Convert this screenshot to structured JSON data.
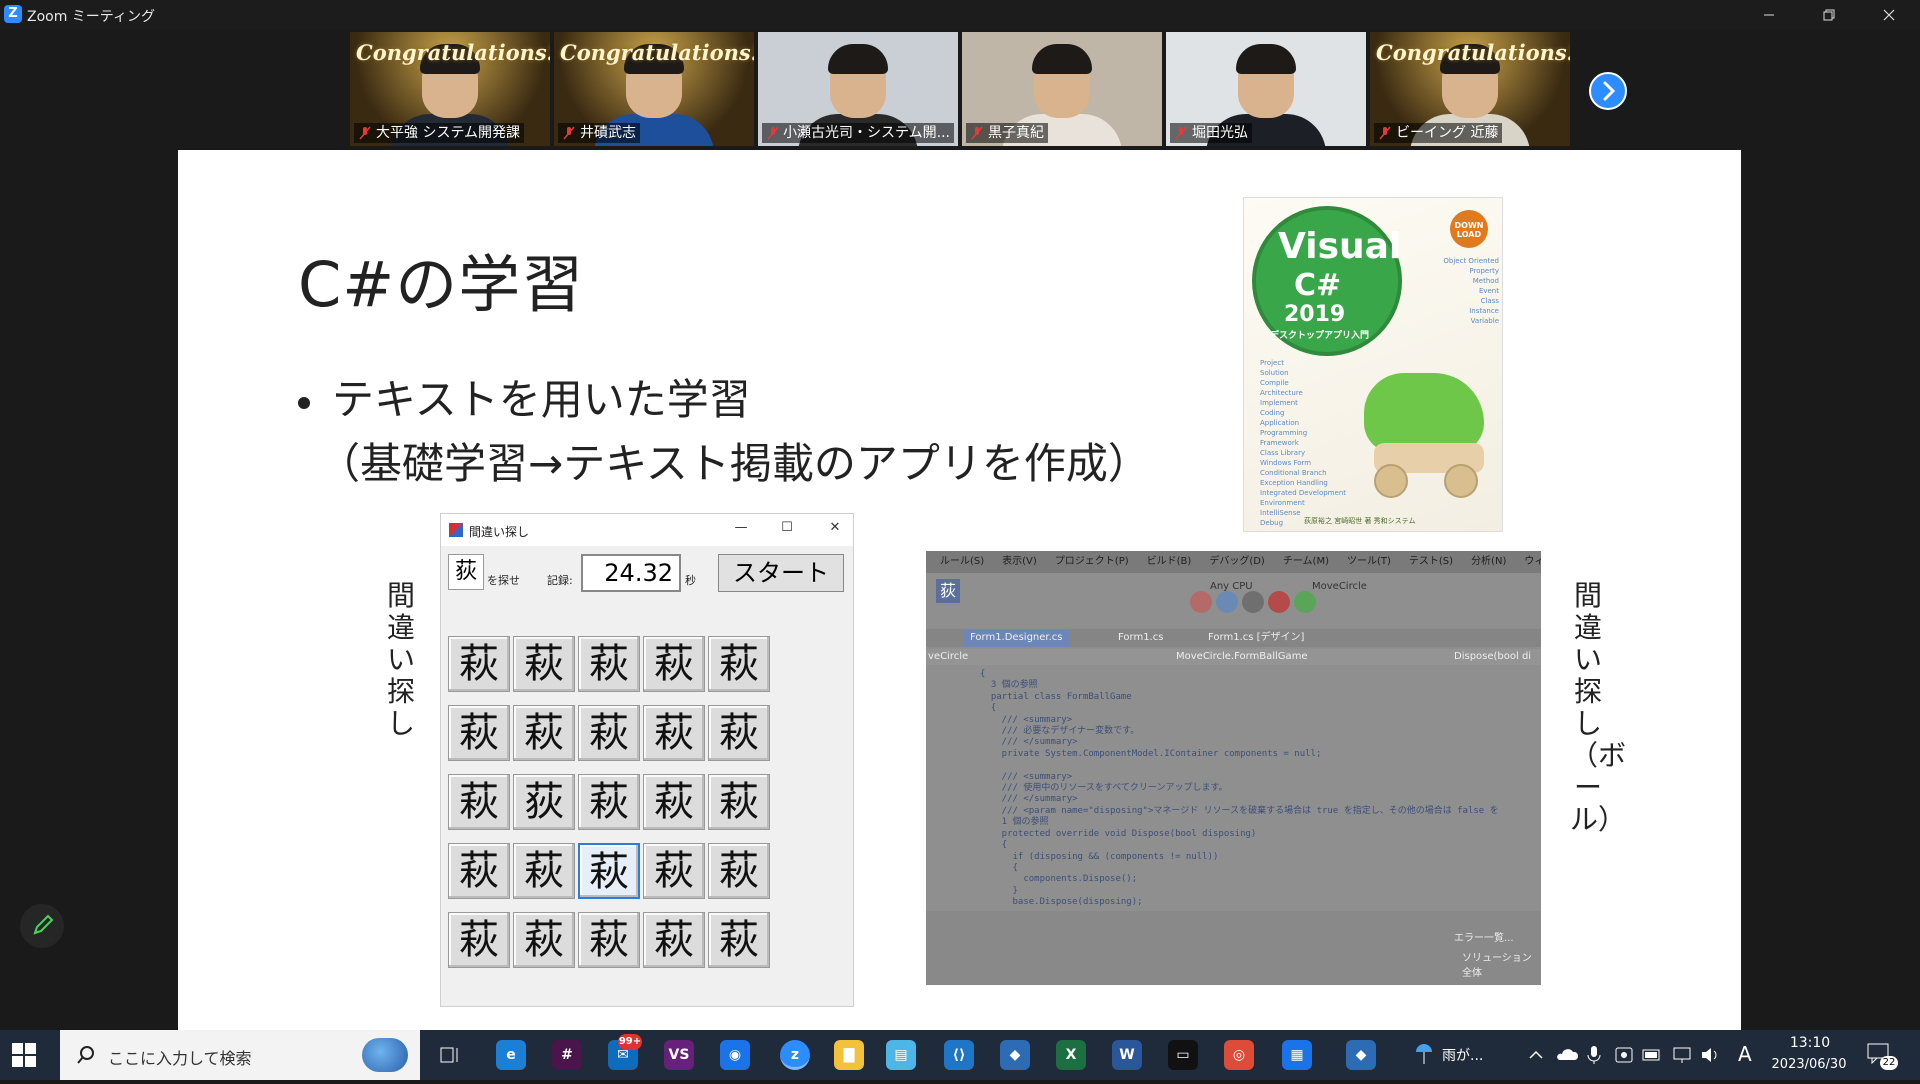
{
  "window": {
    "title": "Zoom ミーティング",
    "logo": "Z"
  },
  "participants": [
    {
      "name": "大平強 システム開発課",
      "overlay": "Congratulations!",
      "bg": "#3a2a12",
      "shirt": "#222a35"
    },
    {
      "name": "井磧武志",
      "overlay": "Congratulations!",
      "bg": "#3a2a12",
      "shirt": "#1d4f9a"
    },
    {
      "name": "小瀬古光司・システム開...",
      "overlay": "",
      "bg": "#c9cfd4",
      "shirt": "#2a2a2a"
    },
    {
      "name": "黒子真紀",
      "overlay": "",
      "bg": "#c0b6a8",
      "shirt": "#e8e2da"
    },
    {
      "name": "堀田光弘",
      "overlay": "",
      "bg": "#dfe3e6",
      "shirt": "#1d1f26"
    },
    {
      "name": "ビーイング  近藤",
      "overlay": "Congratulations!",
      "bg": "#3a2a12",
      "shirt": "#d9d4c8"
    }
  ],
  "slide": {
    "title": "C#の学習",
    "bullet": "テキストを用いた学習",
    "sub": "（基礎学習→テキスト掲載のアプリを作成）",
    "left_label": "間違い探し",
    "right_label": "間違い探し（ボール）"
  },
  "book": {
    "line1": "Visual",
    "line2": "C#",
    "line3": "2019",
    "jp": "デスクトップアプリ入門",
    "download": "DOWN LOAD",
    "keywords": [
      "Object Oriented",
      "Property",
      "Method",
      "Event",
      "Class",
      "Instance",
      "Variable"
    ],
    "keywords2": [
      "Project",
      "Solution",
      "Compile",
      "Architecture",
      "Implement",
      "Coding",
      "Application",
      "Programming",
      "Framework",
      "Class Library",
      "Windows Form",
      "Conditional Branch",
      "Exception Handling",
      "Integrated Development Environment",
      "IntelliSense",
      "Debug"
    ],
    "publisher": "荻原裕之 宮崎昭世 著  秀和システム"
  },
  "game": {
    "title": "間違い探し",
    "target": "荻",
    "find_label": "を探せ",
    "record_label": "記録:",
    "time": "24.32",
    "unit": "秒",
    "start": "スタート",
    "grid": [
      [
        "萩",
        "萩",
        "萩",
        "萩",
        "萩"
      ],
      [
        "萩",
        "萩",
        "萩",
        "萩",
        "萩"
      ],
      [
        "萩",
        "荻",
        "萩",
        "萩",
        "萩"
      ],
      [
        "萩",
        "萩",
        "萩",
        "萩",
        "萩"
      ],
      [
        "萩",
        "萩",
        "萩",
        "萩",
        "萩"
      ]
    ]
  },
  "ide": {
    "menu": [
      "ルール(S)",
      "表示(V)",
      "プロジェクト(P)",
      "ビルド(B)",
      "デバッグ(D)",
      "チーム(M)",
      "ツール(T)",
      "テスト(S)",
      "分析(N)",
      "ウィンドウ(W)"
    ],
    "tabs": [
      "Form1.Designer.cs",
      "Form1.cs",
      "Form1.cs [デザイン]"
    ],
    "codebar_left": "veCircle",
    "codebar_mid": "MoveCircle.FormBallGame",
    "codebar_right": "Dispose(bool di",
    "config": "Any CPU",
    "project": "MoveCircle",
    "code": "{\n  3 個の参照\n  partial class FormBallGame\n  {\n    /// <summary>\n    /// 必要なデザイナー変数です。\n    /// </summary>\n    private System.ComponentModel.IContainer components = null;\n\n    /// <summary>\n    /// 使用中のリソースをすべてクリーンアップします。\n    /// </summary>\n    /// <param name=\"disposing\">マネージド リソースを破棄する場合は true を指定し、その他の場合は false を\n    1 個の参照\n    protected override void Dispose(bool disposing)\n    {\n      if (disposing && (components != null))\n      {\n        components.Dispose();\n      }\n      base.Dispose(disposing);",
    "error_tab": "エラー一覧...",
    "solution": "ソリューション全体"
  },
  "taskbar": {
    "search_placeholder": "ここに入力して検索",
    "weather": "雨が...",
    "ime": "A",
    "time": "13:10",
    "date": "2023/06/30",
    "notifications": "22",
    "mail_badge": "99+",
    "apps": [
      {
        "name": "edge",
        "bg": "#1b7fd6",
        "glyph": "e"
      },
      {
        "name": "slack",
        "bg": "#4a154b",
        "glyph": "#"
      },
      {
        "name": "mail",
        "bg": "#0f6cbd",
        "glyph": "✉"
      },
      {
        "name": "visual-studio",
        "bg": "#68217a",
        "glyph": "VS"
      },
      {
        "name": "maps",
        "bg": "#1a73e8",
        "glyph": "◉"
      },
      {
        "name": "zoom",
        "bg": "#2d8cff",
        "glyph": "z"
      },
      {
        "name": "explorer",
        "bg": "#f3c13a",
        "glyph": "▇"
      },
      {
        "name": "notes",
        "bg": "#4db6e6",
        "glyph": "▤"
      },
      {
        "name": "vscode",
        "bg": "#1f76c6",
        "glyph": "⟨⟩"
      },
      {
        "name": "app-blue",
        "bg": "#2d6bb5",
        "glyph": "◆"
      },
      {
        "name": "excel",
        "bg": "#1d6f42",
        "glyph": "X"
      },
      {
        "name": "word",
        "bg": "#2b579a",
        "glyph": "W"
      },
      {
        "name": "terminal",
        "bg": "#111111",
        "glyph": "▭"
      },
      {
        "name": "chrome",
        "bg": "#dd4b39",
        "glyph": "◎"
      },
      {
        "name": "calendar",
        "bg": "#1a73e8",
        "glyph": "▦"
      },
      {
        "name": "app-green",
        "bg": "#2d6bb5",
        "glyph": "◆"
      }
    ]
  }
}
